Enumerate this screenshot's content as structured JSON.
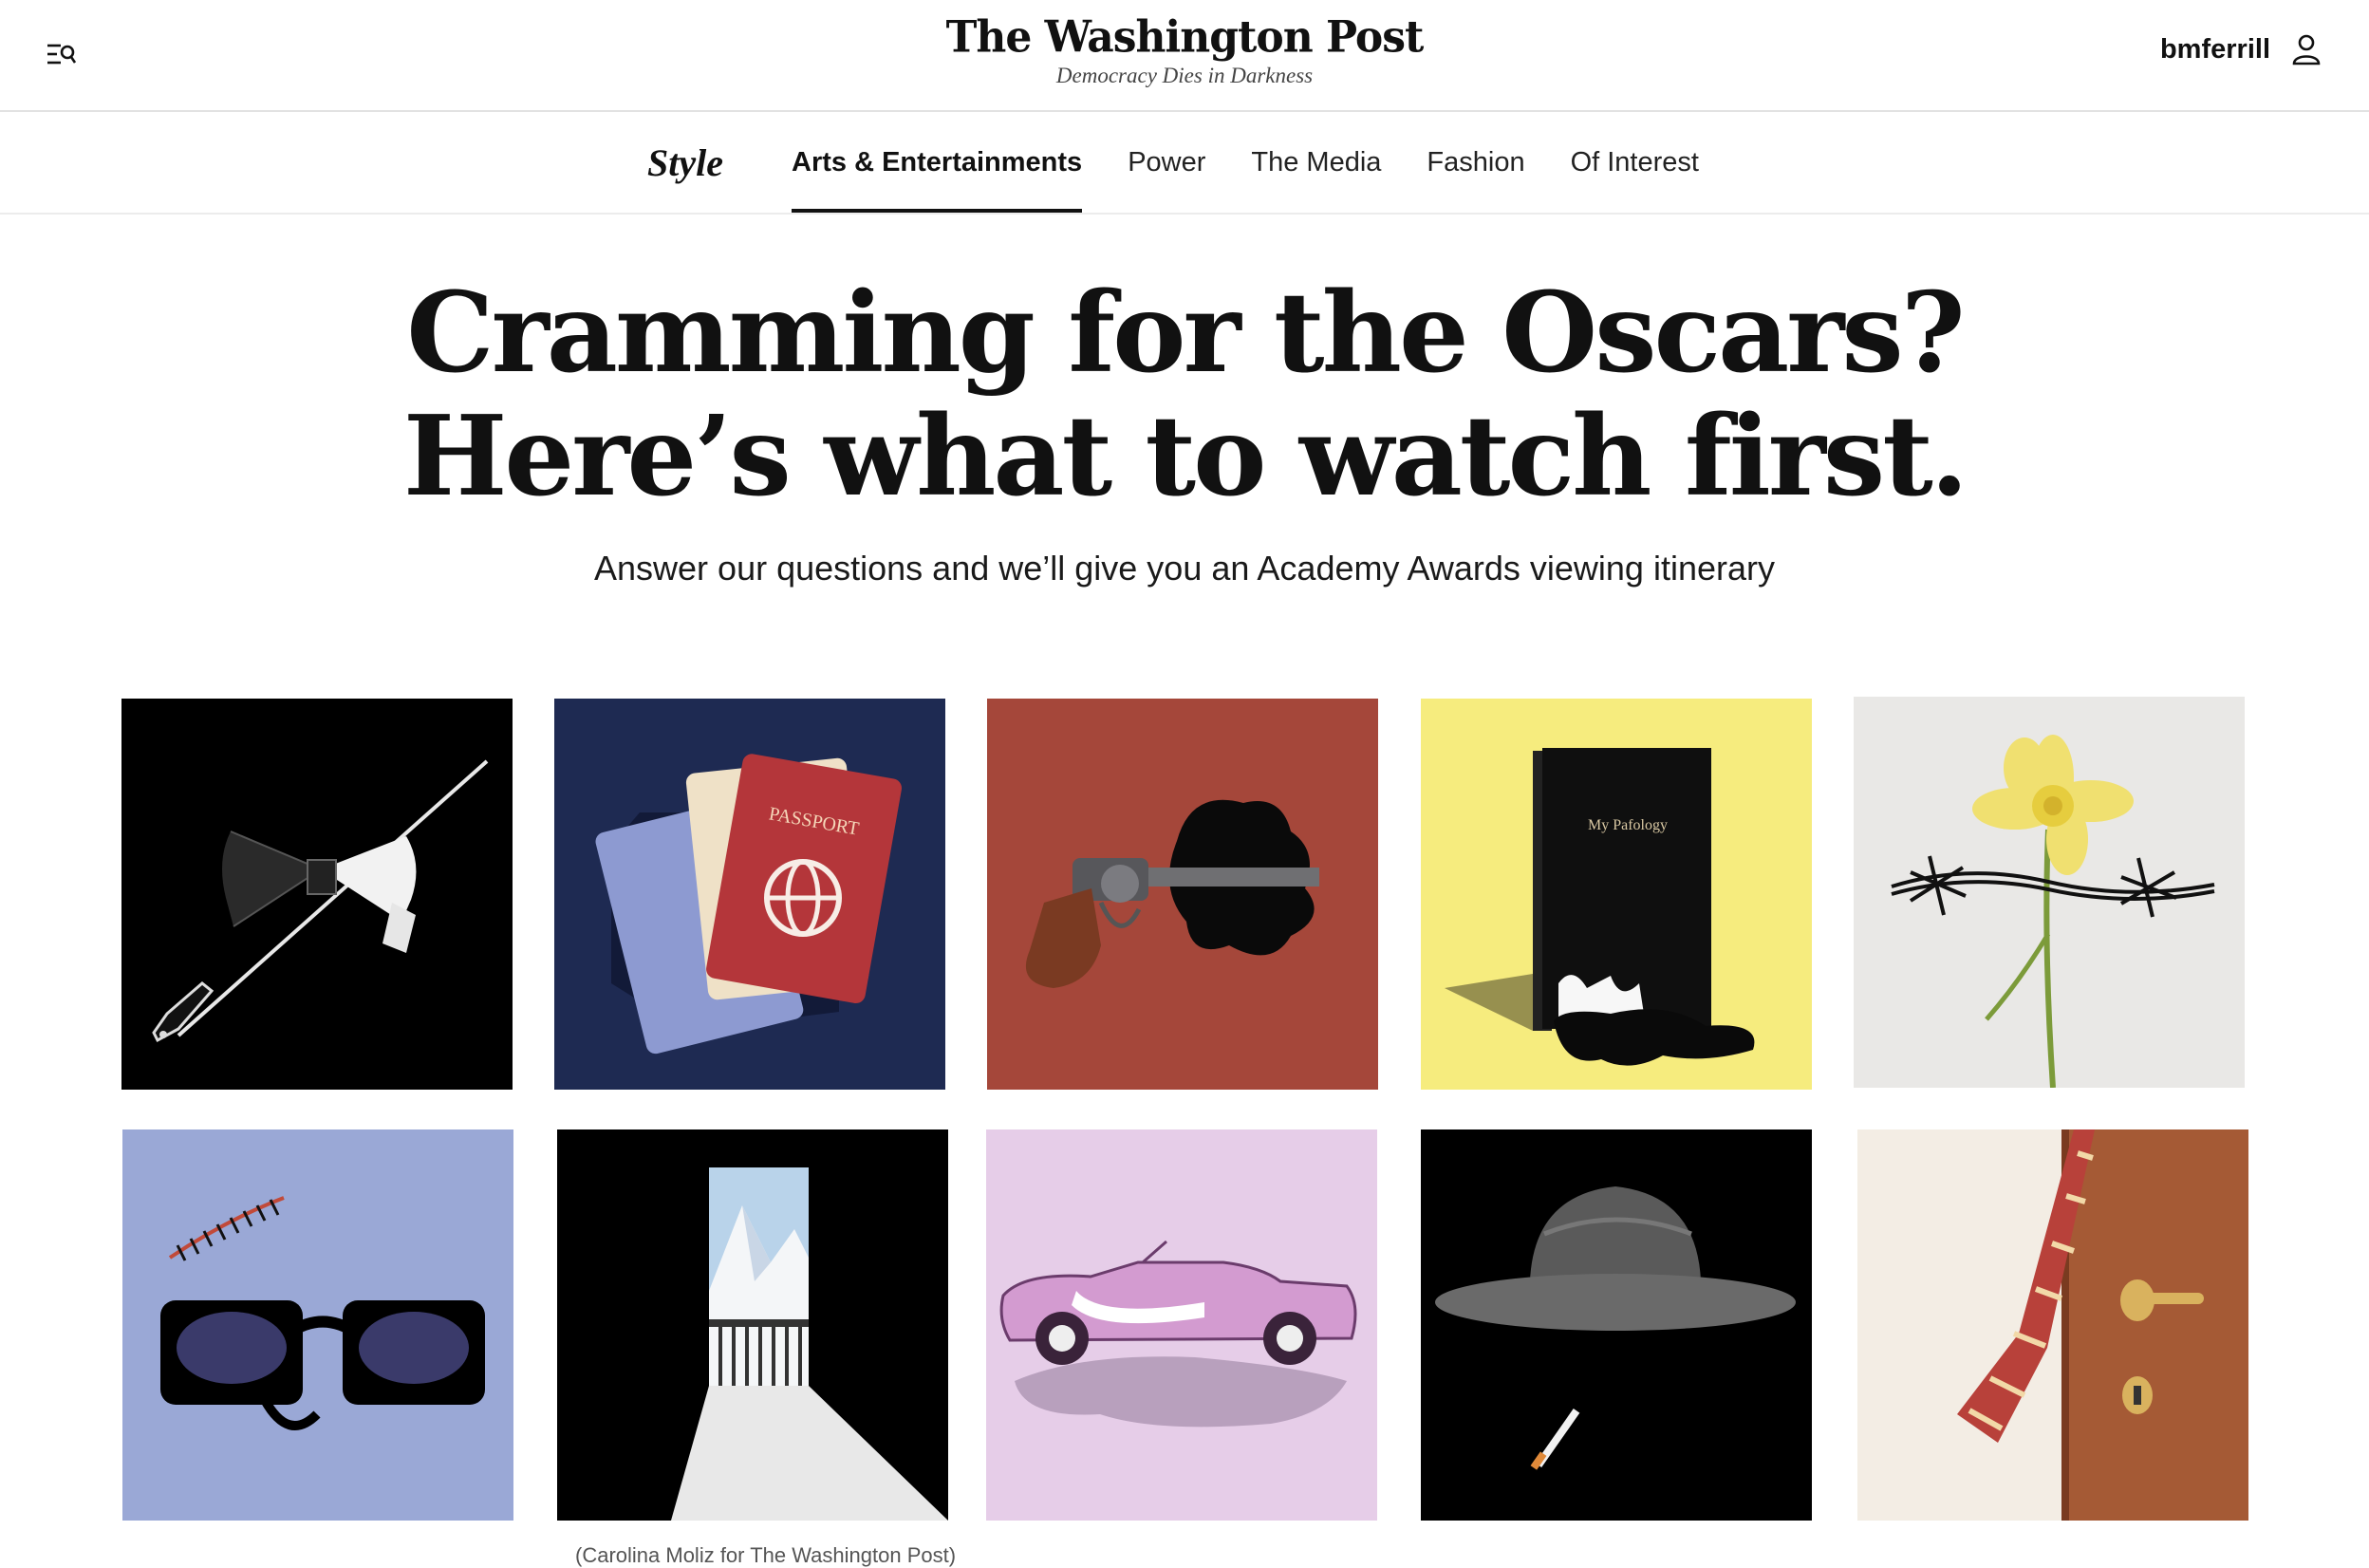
{
  "header": {
    "menu_icon": "menu-search-icon",
    "masthead_title": "The Washington Post",
    "masthead_tagline": "Democracy Dies in Darkness",
    "username": "bmferrill",
    "user_icon": "user-icon"
  },
  "section_nav": {
    "section_logo": "Style",
    "items": [
      {
        "label": "Arts & Entertainments",
        "active": true
      },
      {
        "label": "Power",
        "active": false
      },
      {
        "label": "The Media",
        "active": false
      },
      {
        "label": "Fashion",
        "active": false
      },
      {
        "label": "Of Interest",
        "active": false
      }
    ]
  },
  "article": {
    "headline_line1": "Cramming for the Oscars?",
    "headline_line2": "Here’s what to watch first.",
    "dek": "Answer our questions and we’ll give you an Academy Awards viewing itinerary",
    "caption": "(Carolina Moliz for The Washington Post)"
  },
  "grid": {
    "tiles": [
      {
        "name": "bow-tie-baton-tile",
        "bg": "#000000"
      },
      {
        "name": "passports-tile",
        "bg": "#1e2a52",
        "passport_label": "PASSPORT"
      },
      {
        "name": "revolver-tile",
        "bg": "#a5473a"
      },
      {
        "name": "book-tile",
        "bg": "#f6ec7e",
        "book_title": "My Pafology"
      },
      {
        "name": "daffodil-barbed-wire-tile",
        "bg": "#e9e8e6"
      },
      {
        "name": "sunglasses-tile",
        "bg": "#9aa8d6"
      },
      {
        "name": "doorway-mountains-tile",
        "bg": "#000000"
      },
      {
        "name": "pink-car-tile",
        "bg": "#e6cde8"
      },
      {
        "name": "hat-cigarette-tile",
        "bg": "#000000"
      },
      {
        "name": "door-tie-tile",
        "bg": "#f3ede4"
      }
    ]
  }
}
